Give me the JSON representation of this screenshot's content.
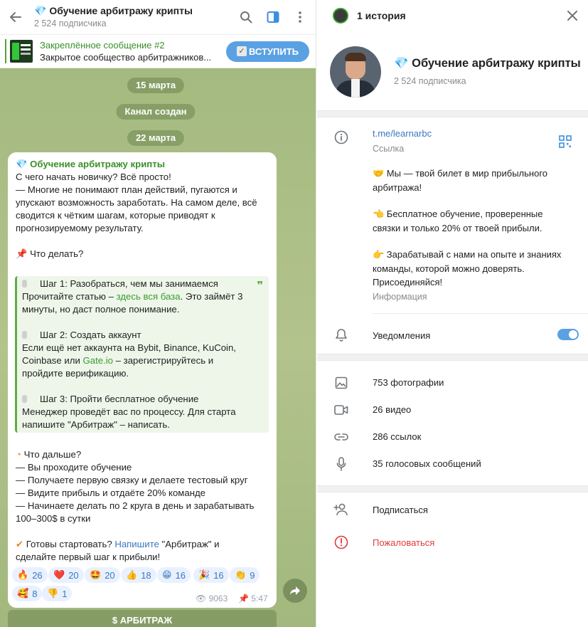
{
  "chat": {
    "title": "💎 Обучение арбитражу крипты",
    "subscribers": "2 524 подписчика",
    "pinned": {
      "title": "Закреплённое сообщение #2",
      "text": "Закрытое сообщество арбитражников...",
      "join_label": "ВСТУПИТЬ"
    },
    "dates": [
      "15 марта",
      "Канал создан",
      "22 марта"
    ],
    "message": {
      "channel": "💎 Обучение арбитражу крипты",
      "lines": [
        "С чего начать новичку? Всё просто!",
        "— Многие не понимают план действий, пугаются и",
        "упускают возможность заработать. На самом деле, всё",
        "сводится к чётким шагам, которые приводят к",
        "прогнозируемому результату.",
        "📌 Что делать?"
      ],
      "quote": {
        "step1_title": "Шаг 1: Разобраться, чем мы занимаемся",
        "step1_a": "Прочитайте статью – ",
        "step1_link": "здесь вся база",
        "step1_b": ". Это займёт 3",
        "step1_c": "минуты, но даст полное понимание.",
        "step2_title": "Шаг 2: Создать аккаунт",
        "step2_a": "Если ещё нет аккаунта на Bybit, Binance, KuCoin,",
        "step2_b1": "Coinbase или ",
        "step2_link": "Gate.io",
        "step2_b2": " – зарегистрируйтесь и",
        "step2_c": "пройдите верификацию.",
        "step3_title": "Шаг 3: Пройти бесплатное обучение",
        "step3_a": "Менеджер проведёт вас по процессу. Для старта",
        "step3_b": "напишите \"Арбитраж\" – написать."
      },
      "next_title": "Что дальше?",
      "next_lines": [
        "— Вы проходите обучение",
        "— Получаете первую связку и делаете тестовый круг",
        "— Видите прибыль и отдаёте 20% команде",
        "— Начинаете делать по 2 круга в день и зарабатывать",
        "100–300$ в сутки"
      ],
      "cta_a": "Готовы стартовать? ",
      "cta_link": "Напишите",
      "cta_b": " \"Арбитраж\" и",
      "cta_c": "сделайте первый шаг к прибыли!",
      "reactions": [
        {
          "emoji": "🔥",
          "count": "26"
        },
        {
          "emoji": "❤️",
          "count": "20"
        },
        {
          "emoji": "🤩",
          "count": "20"
        },
        {
          "emoji": "👍",
          "count": "18"
        },
        {
          "emoji": "😁",
          "count": "16"
        },
        {
          "emoji": "🎉",
          "count": "16"
        },
        {
          "emoji": "👏",
          "count": "9"
        },
        {
          "emoji": "🥰",
          "count": "8"
        },
        {
          "emoji": "👎",
          "count": "1"
        }
      ],
      "views": "9063",
      "time": "5:47"
    },
    "bot_button": "$ АРБИТРАЖ"
  },
  "info": {
    "header_title": "1 история",
    "name": "💎 Обучение арбитражу крипты",
    "subscribers": "2 524 подписчика",
    "link": "t.me/learnarbc",
    "link_caption": "Ссылка",
    "about": [
      "🤝 Мы — твой билет в мир прибыльного",
      "арбитража!",
      "",
      "👈 Бесплатное обучение, проверенные",
      "связки и только 20% от твоей прибыли.",
      "",
      "👉 Зарабатывай с нами на опыте и знаниях",
      "команды, которой можно доверять.",
      "Присоединяйся!"
    ],
    "about_caption": "Информация",
    "notifications": "Уведомления",
    "notifications_on": true,
    "media": {
      "photos": "753 фотографии",
      "videos": "26 видео",
      "links": "286 ссылок",
      "voice": "35 голосовых сообщений"
    },
    "subscribe": "Подписаться",
    "report": "Пожаловаться"
  },
  "colors": {
    "accent_blue": "#5aa1e3",
    "channel_green": "#3a8f2b",
    "report_red": "#e03b3b",
    "chat_bg": "#a9bd86"
  }
}
